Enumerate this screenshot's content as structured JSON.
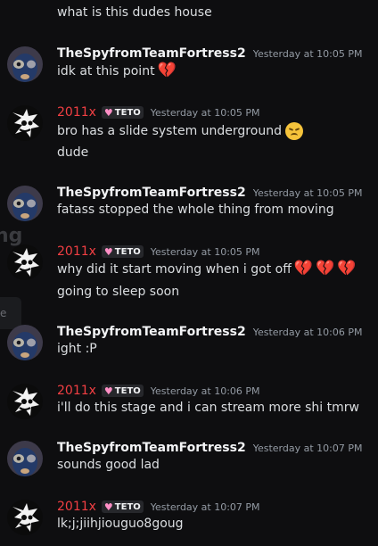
{
  "ghost": {
    "partial_g": "ng",
    "partial_e": "e"
  },
  "top_continuation": "what is this dudes house",
  "users": {
    "spy": {
      "name": "TheSpyfromTeamFortress2"
    },
    "x": {
      "name": "2011x",
      "tag": "TETO"
    }
  },
  "messages": [
    {
      "author": "spy",
      "timestamp": "Yesterday at 10:05 PM",
      "lines": [
        "idk at this point"
      ]
    },
    {
      "author": "x",
      "timestamp": "Yesterday at 10:05 PM",
      "lines": [
        "bro has a slide system underground",
        "dude"
      ]
    },
    {
      "author": "spy",
      "timestamp": "Yesterday at 10:05 PM",
      "lines": [
        "fatass stopped the whole thing from moving"
      ]
    },
    {
      "author": "x",
      "timestamp": "Yesterday at 10:05 PM",
      "lines": [
        "why did it start moving when i got off",
        "going to sleep soon"
      ]
    },
    {
      "author": "spy",
      "timestamp": "Yesterday at 10:06 PM",
      "lines": [
        "ight :P"
      ]
    },
    {
      "author": "x",
      "timestamp": "Yesterday at 10:06 PM",
      "lines": [
        "i'll do this stage and i can stream more shi tmrw"
      ]
    },
    {
      "author": "spy",
      "timestamp": "Yesterday at 10:07 PM",
      "lines": [
        "sounds good lad"
      ]
    },
    {
      "author": "x",
      "timestamp": "Yesterday at 10:07 PM",
      "lines": [
        "lk;j;jiihjiouguo8goug"
      ]
    }
  ],
  "emoji": {
    "broken_heart": "💔",
    "disappointed": "disappointed-face"
  },
  "colors": {
    "background": "#0e0e10",
    "red_name": "#f23f43",
    "white_name": "#f2f3f5",
    "timestamp": "#949ba4",
    "tag_heart": "#ff8fc6"
  }
}
